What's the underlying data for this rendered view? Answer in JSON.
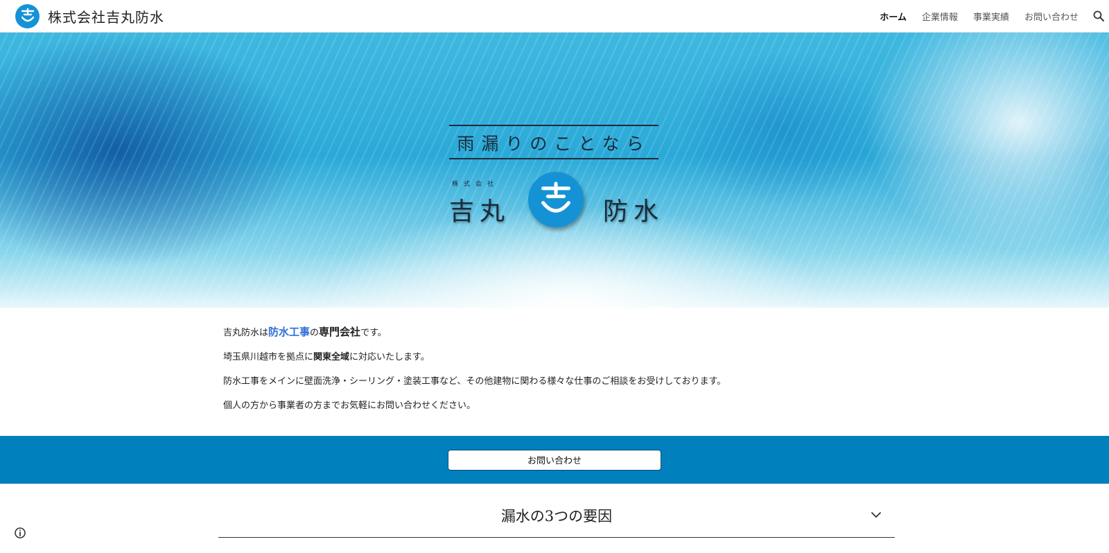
{
  "header": {
    "brand_name": "株式会社吉丸防水",
    "logo_icon": "yoshi-emblem-icon",
    "nav": [
      {
        "label": "ホーム",
        "active": true
      },
      {
        "label": "企業情報",
        "active": false
      },
      {
        "label": "事業実績",
        "active": false
      },
      {
        "label": "お問い合わせ",
        "active": false
      }
    ],
    "search_icon": "search-icon"
  },
  "hero": {
    "tagline": "雨漏りのことなら",
    "company_prefix": "株式会社",
    "name_left": "吉丸",
    "name_right": "防水"
  },
  "intro": {
    "line1": {
      "pre": "吉丸防水は",
      "accent": "防水工事",
      "mid": "の",
      "strong": "専門会社",
      "post": "です。"
    },
    "line2": {
      "pre": "埼玉県川越市を拠点に",
      "strong": "関東全域",
      "post": "に対応いたします。"
    },
    "line3": "防水工事をメインに壁面洗浄・シーリング・塗装工事など、その他建物に関わる様々な仕事のご相談をお受けしております。",
    "line4": "個人の方から事業者の方までお気軽にお問い合わせください。"
  },
  "cta": {
    "label": "お問い合わせ"
  },
  "accordion": {
    "title": "漏水の3つの要因",
    "icon": "chevron-down-icon"
  },
  "colors": {
    "brand_blue": "#1592d6",
    "cta_band": "#0080bd",
    "accent_text": "#2f6fd8"
  },
  "info_icon": "info-icon"
}
